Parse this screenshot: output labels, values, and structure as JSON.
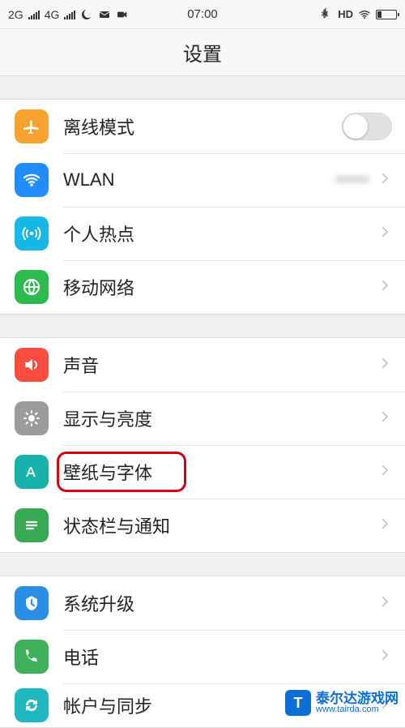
{
  "status": {
    "net1_label": "2G",
    "net2_label": "4G",
    "time": "07:00",
    "hd_label": "HD"
  },
  "header": {
    "title": "设置"
  },
  "groups": [
    {
      "rows": [
        {
          "key": "airplane",
          "label": "离线模式"
        },
        {
          "key": "wlan",
          "label": "WLAN",
          "value": "••••••"
        },
        {
          "key": "hotspot",
          "label": "个人热点"
        },
        {
          "key": "cellular",
          "label": "移动网络"
        }
      ]
    },
    {
      "rows": [
        {
          "key": "sound",
          "label": "声音"
        },
        {
          "key": "display",
          "label": "显示与亮度"
        },
        {
          "key": "wallpaper",
          "label": "壁纸与字体"
        },
        {
          "key": "notifications",
          "label": "状态栏与通知"
        }
      ]
    },
    {
      "rows": [
        {
          "key": "update",
          "label": "系统升级"
        },
        {
          "key": "phone",
          "label": "电话"
        },
        {
          "key": "accounts",
          "label": "帐户与同步"
        }
      ]
    }
  ],
  "watermark": {
    "cn": "泰尔达游戏网",
    "en": "www.tairda.com"
  }
}
